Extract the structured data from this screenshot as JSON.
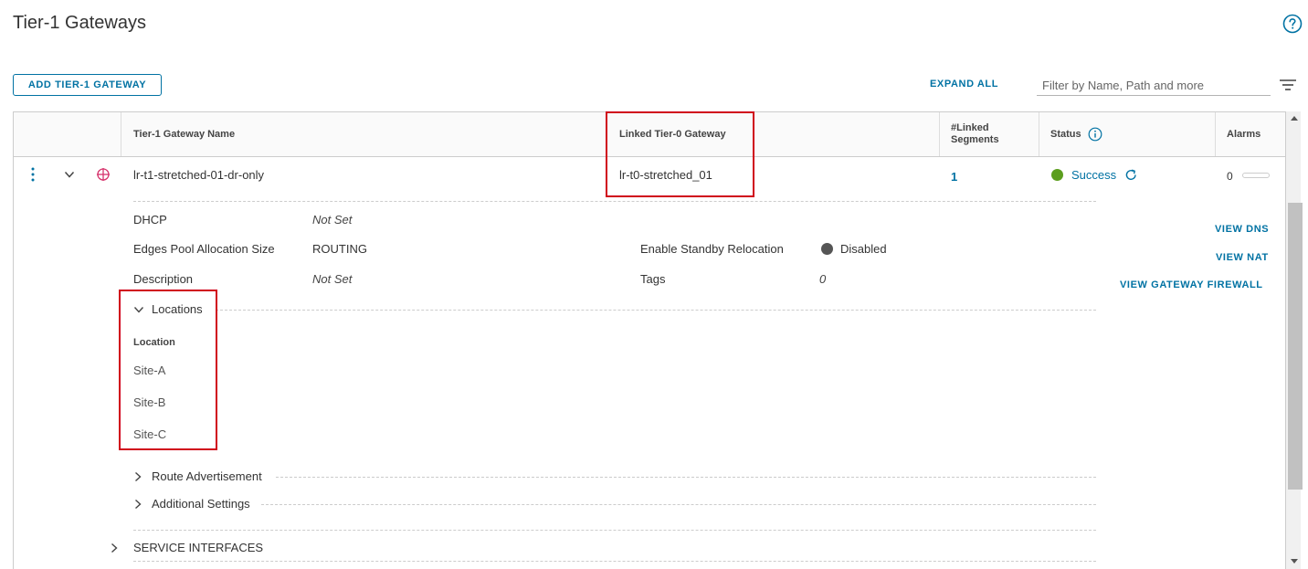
{
  "page": {
    "title": "Tier-1 Gateways"
  },
  "toolbar": {
    "add_label": "ADD TIER-1 GATEWAY",
    "expand_all_label": "EXPAND ALL",
    "filter_placeholder": "Filter by Name, Path and more"
  },
  "table": {
    "headers": {
      "name": "Tier-1 Gateway Name",
      "linked_t0": "Linked Tier-0 Gateway",
      "linked_segments": "#Linked Segments",
      "status": "Status",
      "alarms": "Alarms"
    },
    "row": {
      "name": "lr-t1-stretched-01-dr-only",
      "linked_t0": "lr-t0-stretched_01",
      "linked_segments": "1",
      "status": "Success",
      "alarms": "0"
    }
  },
  "details": {
    "dhcp_label": "DHCP",
    "dhcp_value": "Not Set",
    "edges_label": "Edges Pool Allocation Size",
    "edges_value": "ROUTING",
    "description_label": "Description",
    "description_value": "Not Set",
    "standby_label": "Enable Standby Relocation",
    "standby_value": "Disabled",
    "tags_label": "Tags",
    "tags_value": "0",
    "actions": [
      "VIEW DNS",
      "VIEW NAT",
      "VIEW GATEWAY FIREWALL"
    ]
  },
  "locations": {
    "toggle_label": "Locations",
    "column_header": "Location",
    "items": [
      "Site-A",
      "Site-B",
      "Site-C"
    ]
  },
  "sections": {
    "route_advertisement": "Route Advertisement",
    "additional_settings": "Additional Settings",
    "service_interfaces": "SERVICE INTERFACES"
  },
  "colors": {
    "accent": "#0072a3",
    "success": "#5c9e1e",
    "highlight_box": "#d0021b",
    "gateway_icon": "#d6336c"
  },
  "icons": [
    "help-icon",
    "filter-icon",
    "row-menu-icon",
    "chevron-down-icon",
    "gateway-icon",
    "info-icon",
    "refresh-icon",
    "chevron-right-icon"
  ]
}
